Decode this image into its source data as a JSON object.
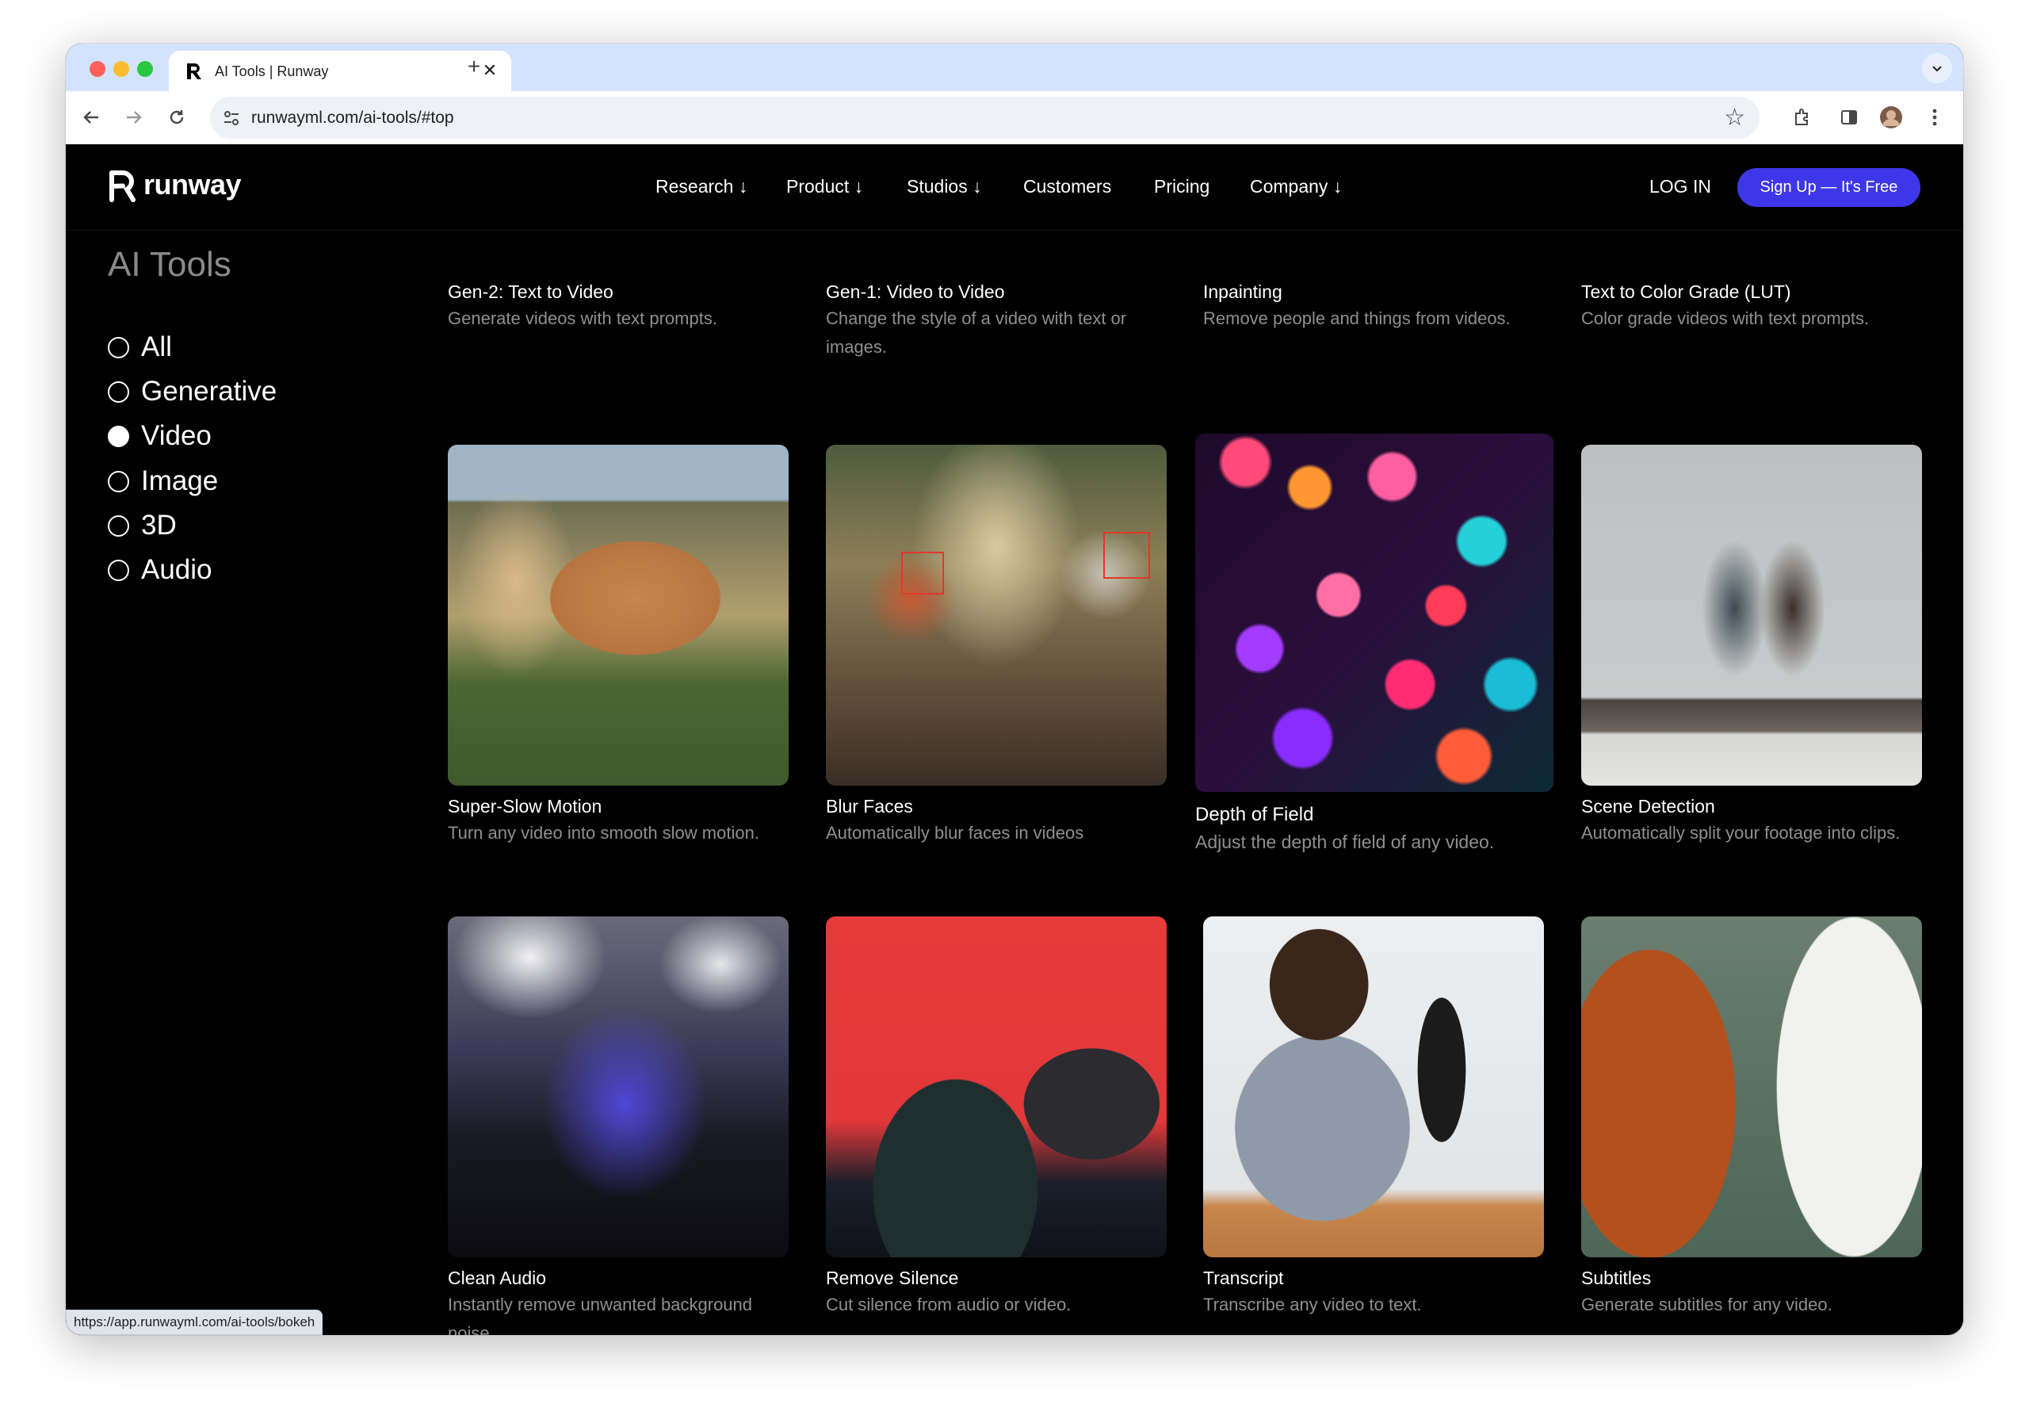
{
  "browser": {
    "tab_title": "AI Tools | Runway",
    "tab_close": "✕",
    "new_tab": "+",
    "url": "runwayml.com/ai-tools/#top",
    "status_url": "https://app.runwayml.com/ai-tools/bokeh"
  },
  "site": {
    "logo_text": "runway",
    "nav": [
      {
        "label": "Research ↓"
      },
      {
        "label": "Product ↓"
      },
      {
        "label": "Studios ↓"
      },
      {
        "label": "Customers"
      },
      {
        "label": "Pricing"
      },
      {
        "label": "Company ↓"
      }
    ],
    "login": "LOG IN",
    "signup": "Sign Up — It's Free"
  },
  "sidebar": {
    "title": "AI Tools",
    "filters": [
      {
        "label": "All",
        "selected": false
      },
      {
        "label": "Generative",
        "selected": false
      },
      {
        "label": "Video",
        "selected": true
      },
      {
        "label": "Image",
        "selected": false
      },
      {
        "label": "3D",
        "selected": false
      },
      {
        "label": "Audio",
        "selected": false
      }
    ]
  },
  "tools_partial_row": [
    {
      "title": "Gen-2: Text to Video",
      "desc": "Generate videos with text prompts."
    },
    {
      "title": "Gen-1: Video to Video",
      "desc": "Change the style of a video with text or images."
    },
    {
      "title": "Inpainting",
      "desc": "Remove people and things from videos."
    },
    {
      "title": "Text to Color Grade (LUT)",
      "desc": "Color grade videos with text prompts."
    }
  ],
  "tools_row2": [
    {
      "title": "Super-Slow Motion",
      "desc": "Turn any video into smooth slow motion."
    },
    {
      "title": "Blur Faces",
      "desc": "Automatically blur faces in videos"
    },
    {
      "title": "Depth of Field",
      "desc": "Adjust the depth of field of any video."
    },
    {
      "title": "Scene Detection",
      "desc": "Automatically split your footage into clips."
    }
  ],
  "tools_row3": [
    {
      "title": "Clean Audio",
      "desc": "Instantly remove unwanted background noise."
    },
    {
      "title": "Remove Silence",
      "desc": "Cut silence from audio or video."
    },
    {
      "title": "Transcript",
      "desc": "Transcribe any video to text."
    },
    {
      "title": "Subtitles",
      "desc": "Generate subtitles for any video."
    }
  ],
  "colors": {
    "signup_bg": "#3e37e9",
    "page_bg": "#000000",
    "tabstrip_bg": "#d3e3fd"
  }
}
